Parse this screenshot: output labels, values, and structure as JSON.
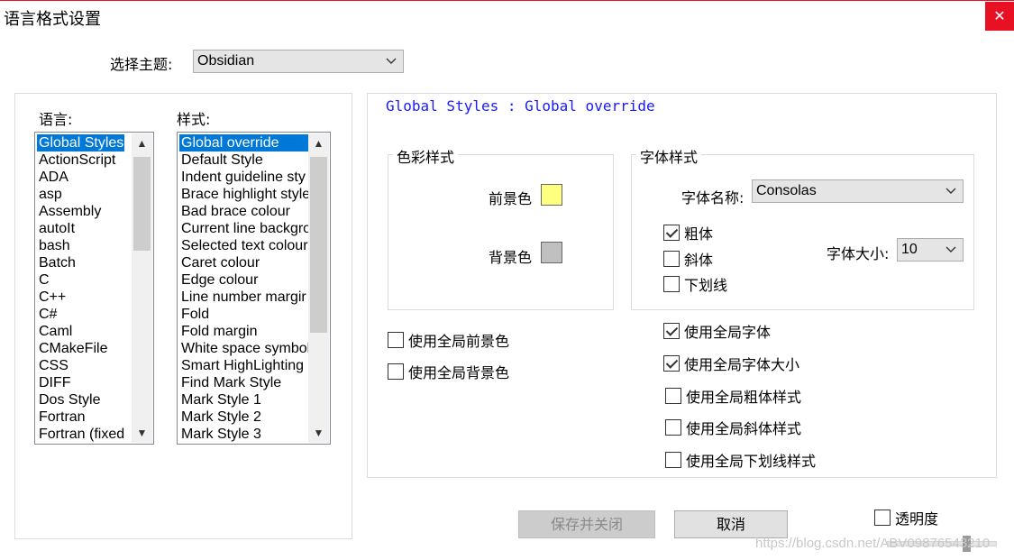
{
  "window": {
    "title": "语言格式设置",
    "close_glyph": "✕"
  },
  "theme": {
    "label": "选择主题:",
    "selected": "Obsidian"
  },
  "languages": {
    "label": "语言:",
    "items": [
      "Global Styles",
      "ActionScript",
      "ADA",
      "asp",
      "Assembly",
      "autoIt",
      "bash",
      "Batch",
      "C",
      "C++",
      "C#",
      "Caml",
      "CMakeFile",
      "CSS",
      "DIFF",
      "Dos Style",
      "Fortran",
      "Fortran (fixed"
    ],
    "selected_index": 0
  },
  "styles": {
    "label": "样式:",
    "items": [
      "Global override",
      "Default Style",
      "Indent guideline sty",
      "Brace highlight style",
      "Bad brace colour",
      "Current line backgro",
      "Selected text colour",
      "Caret colour",
      "Edge colour",
      "Line number margir",
      "Fold",
      "Fold margin",
      "White space symbol",
      "Smart HighLighting",
      "Find Mark Style",
      "Mark Style 1",
      "Mark Style 2",
      "Mark Style 3"
    ],
    "selected_index": 0
  },
  "detail": {
    "header": "Global Styles : Global override",
    "header_color": "#1a1aff",
    "color_group": {
      "title": "色彩样式",
      "fg_label": "前景色",
      "fg_color": "#ffff80",
      "bg_label": "背景色",
      "bg_color": "#c0c0c0"
    },
    "font_group": {
      "title": "字体样式",
      "font_name_label": "字体名称:",
      "font_name": "Consolas",
      "bold_label": "粗体",
      "bold": true,
      "italic_label": "斜体",
      "italic": false,
      "underline_label": "下划线",
      "underline": false,
      "size_label": "字体大小:",
      "size": "10"
    },
    "use_global_fg": {
      "label": "使用全局前景色",
      "checked": false
    },
    "use_global_bg": {
      "label": "使用全局背景色",
      "checked": false
    },
    "use_global_font": {
      "label": "使用全局字体",
      "checked": true
    },
    "use_global_size": {
      "label": "使用全局字体大小",
      "checked": true
    },
    "use_global_bold": {
      "label": "使用全局粗体样式",
      "checked": false
    },
    "use_global_italic": {
      "label": "使用全局斜体样式",
      "checked": false
    },
    "use_global_underline": {
      "label": "使用全局下划线样式",
      "checked": false
    }
  },
  "buttons": {
    "save_close": "保存并关闭",
    "cancel": "取消"
  },
  "transparency": {
    "label": "透明度",
    "checked": false
  },
  "watermark": "https://blog.csdn.net/ABV09876543210"
}
